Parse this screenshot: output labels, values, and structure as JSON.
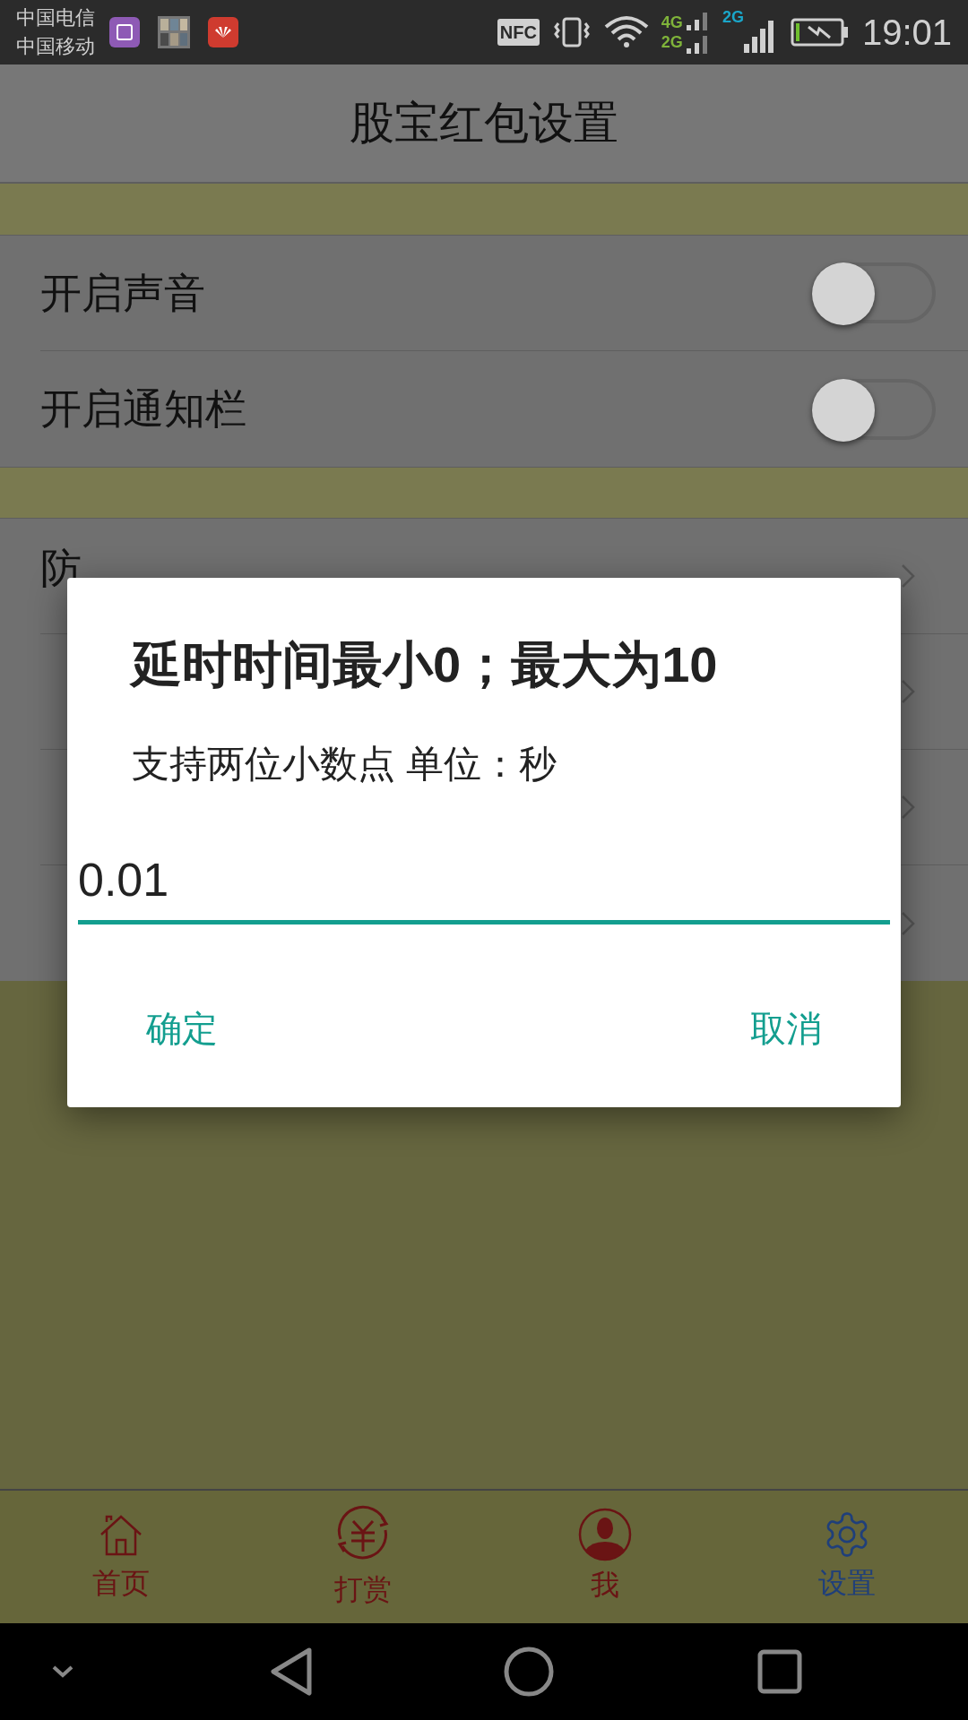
{
  "status_bar": {
    "carriers": [
      "中国电信",
      "中国移动"
    ],
    "nfc": "NFC",
    "net_top": "4G",
    "net_bottom": "2G",
    "net_sim2": "2G",
    "time": "19:01"
  },
  "header": {
    "title": "股宝红包设置"
  },
  "toggle_rows": [
    {
      "label": "开启声音",
      "on": false
    },
    {
      "label": "开启通知栏",
      "on": false
    }
  ],
  "setting_rows": [
    {
      "label": "防"
    },
    {},
    {},
    {}
  ],
  "dialog": {
    "title": "延时时间最小0；最大为10",
    "message": "支持两位小数点 单位：秒",
    "input_value": "0.01",
    "buttons": [
      "确定",
      "取消"
    ]
  },
  "bottom_nav": [
    {
      "label": "首页",
      "kind": "home",
      "selected": false
    },
    {
      "label": "打赏",
      "kind": "reward",
      "selected": false
    },
    {
      "label": "我",
      "kind": "person",
      "selected": false
    },
    {
      "label": "设置",
      "kind": "gear",
      "selected": true
    }
  ]
}
